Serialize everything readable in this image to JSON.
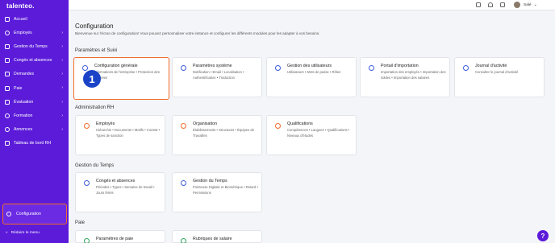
{
  "sidebar": {
    "logo": "talenteo.",
    "items": [
      {
        "label": "Accueil",
        "chevron": ""
      },
      {
        "label": "Employés",
        "chevron": "›"
      },
      {
        "label": "Gestion du Temps",
        "chevron": "›"
      },
      {
        "label": "Congés et absences",
        "chevron": "›"
      },
      {
        "label": "Demandes",
        "chevron": "›"
      },
      {
        "label": "Paie",
        "chevron": "›"
      },
      {
        "label": "Évaluation",
        "chevron": "›"
      },
      {
        "label": "Formation",
        "chevron": "›"
      },
      {
        "label": "Annonces",
        "chevron": "›"
      },
      {
        "label": "Tableau de bord RH",
        "chevron": ""
      }
    ],
    "config_label": "Configuration",
    "collapse_label": "Réduire le menu",
    "collapse_arrow": "«"
  },
  "topbar": {
    "user_name": "Salé",
    "user_chevron": "⌄"
  },
  "main": {
    "title": "Configuration",
    "subtitle": "Bienvenue sur l'écran de configuration! Vous pouvez personnaliser votre instance et configurer les différents modules pour les adapter à vos besoins.",
    "sections": [
      {
        "title": "Paramètres et Suivi"
      },
      {
        "title": "Administration RH"
      },
      {
        "title": "Gestion du Temps"
      },
      {
        "title": "Paie"
      }
    ],
    "cards": [
      {
        "title": "Configuration générale",
        "desc": "Informations de l'entreprise • Protection des données"
      },
      {
        "title": "Paramètres système",
        "desc": "Notification • Email • Localisation • Authentification • Traduction"
      },
      {
        "title": "Gestion des utilisateurs",
        "desc": "Utilisateurs • Mots de passe • Rôles"
      },
      {
        "title": "Portail d'importation",
        "desc": "Importation des employés • Importation des soldes • Importation des salaires"
      },
      {
        "title": "Journal d'activité",
        "desc": "Consulter le journal d'activité"
      },
      {
        "title": "Employés",
        "desc": "Hiérarchie • Documents • Motifs • Contrat • Types de sanction"
      },
      {
        "title": "Organisation",
        "desc": "Établissements • Structures • Équipes de Travailles"
      },
      {
        "title": "Qualifications",
        "desc": "Compétences • Langues • Qualifications • Niveaux d'études"
      },
      {
        "title": "Congés et absences",
        "desc": "Périodes • Types • Semaine de travail • Jours fériés"
      },
      {
        "title": "Gestion du Temps",
        "desc": "Pointeuse Digitale et Biométrique • Retard • Permissions"
      },
      {
        "title": "Paramètres de paie",
        "desc": ""
      },
      {
        "title": "Rubriques de salaire",
        "desc": ""
      }
    ],
    "step_badge": "1",
    "help_label": "?"
  }
}
